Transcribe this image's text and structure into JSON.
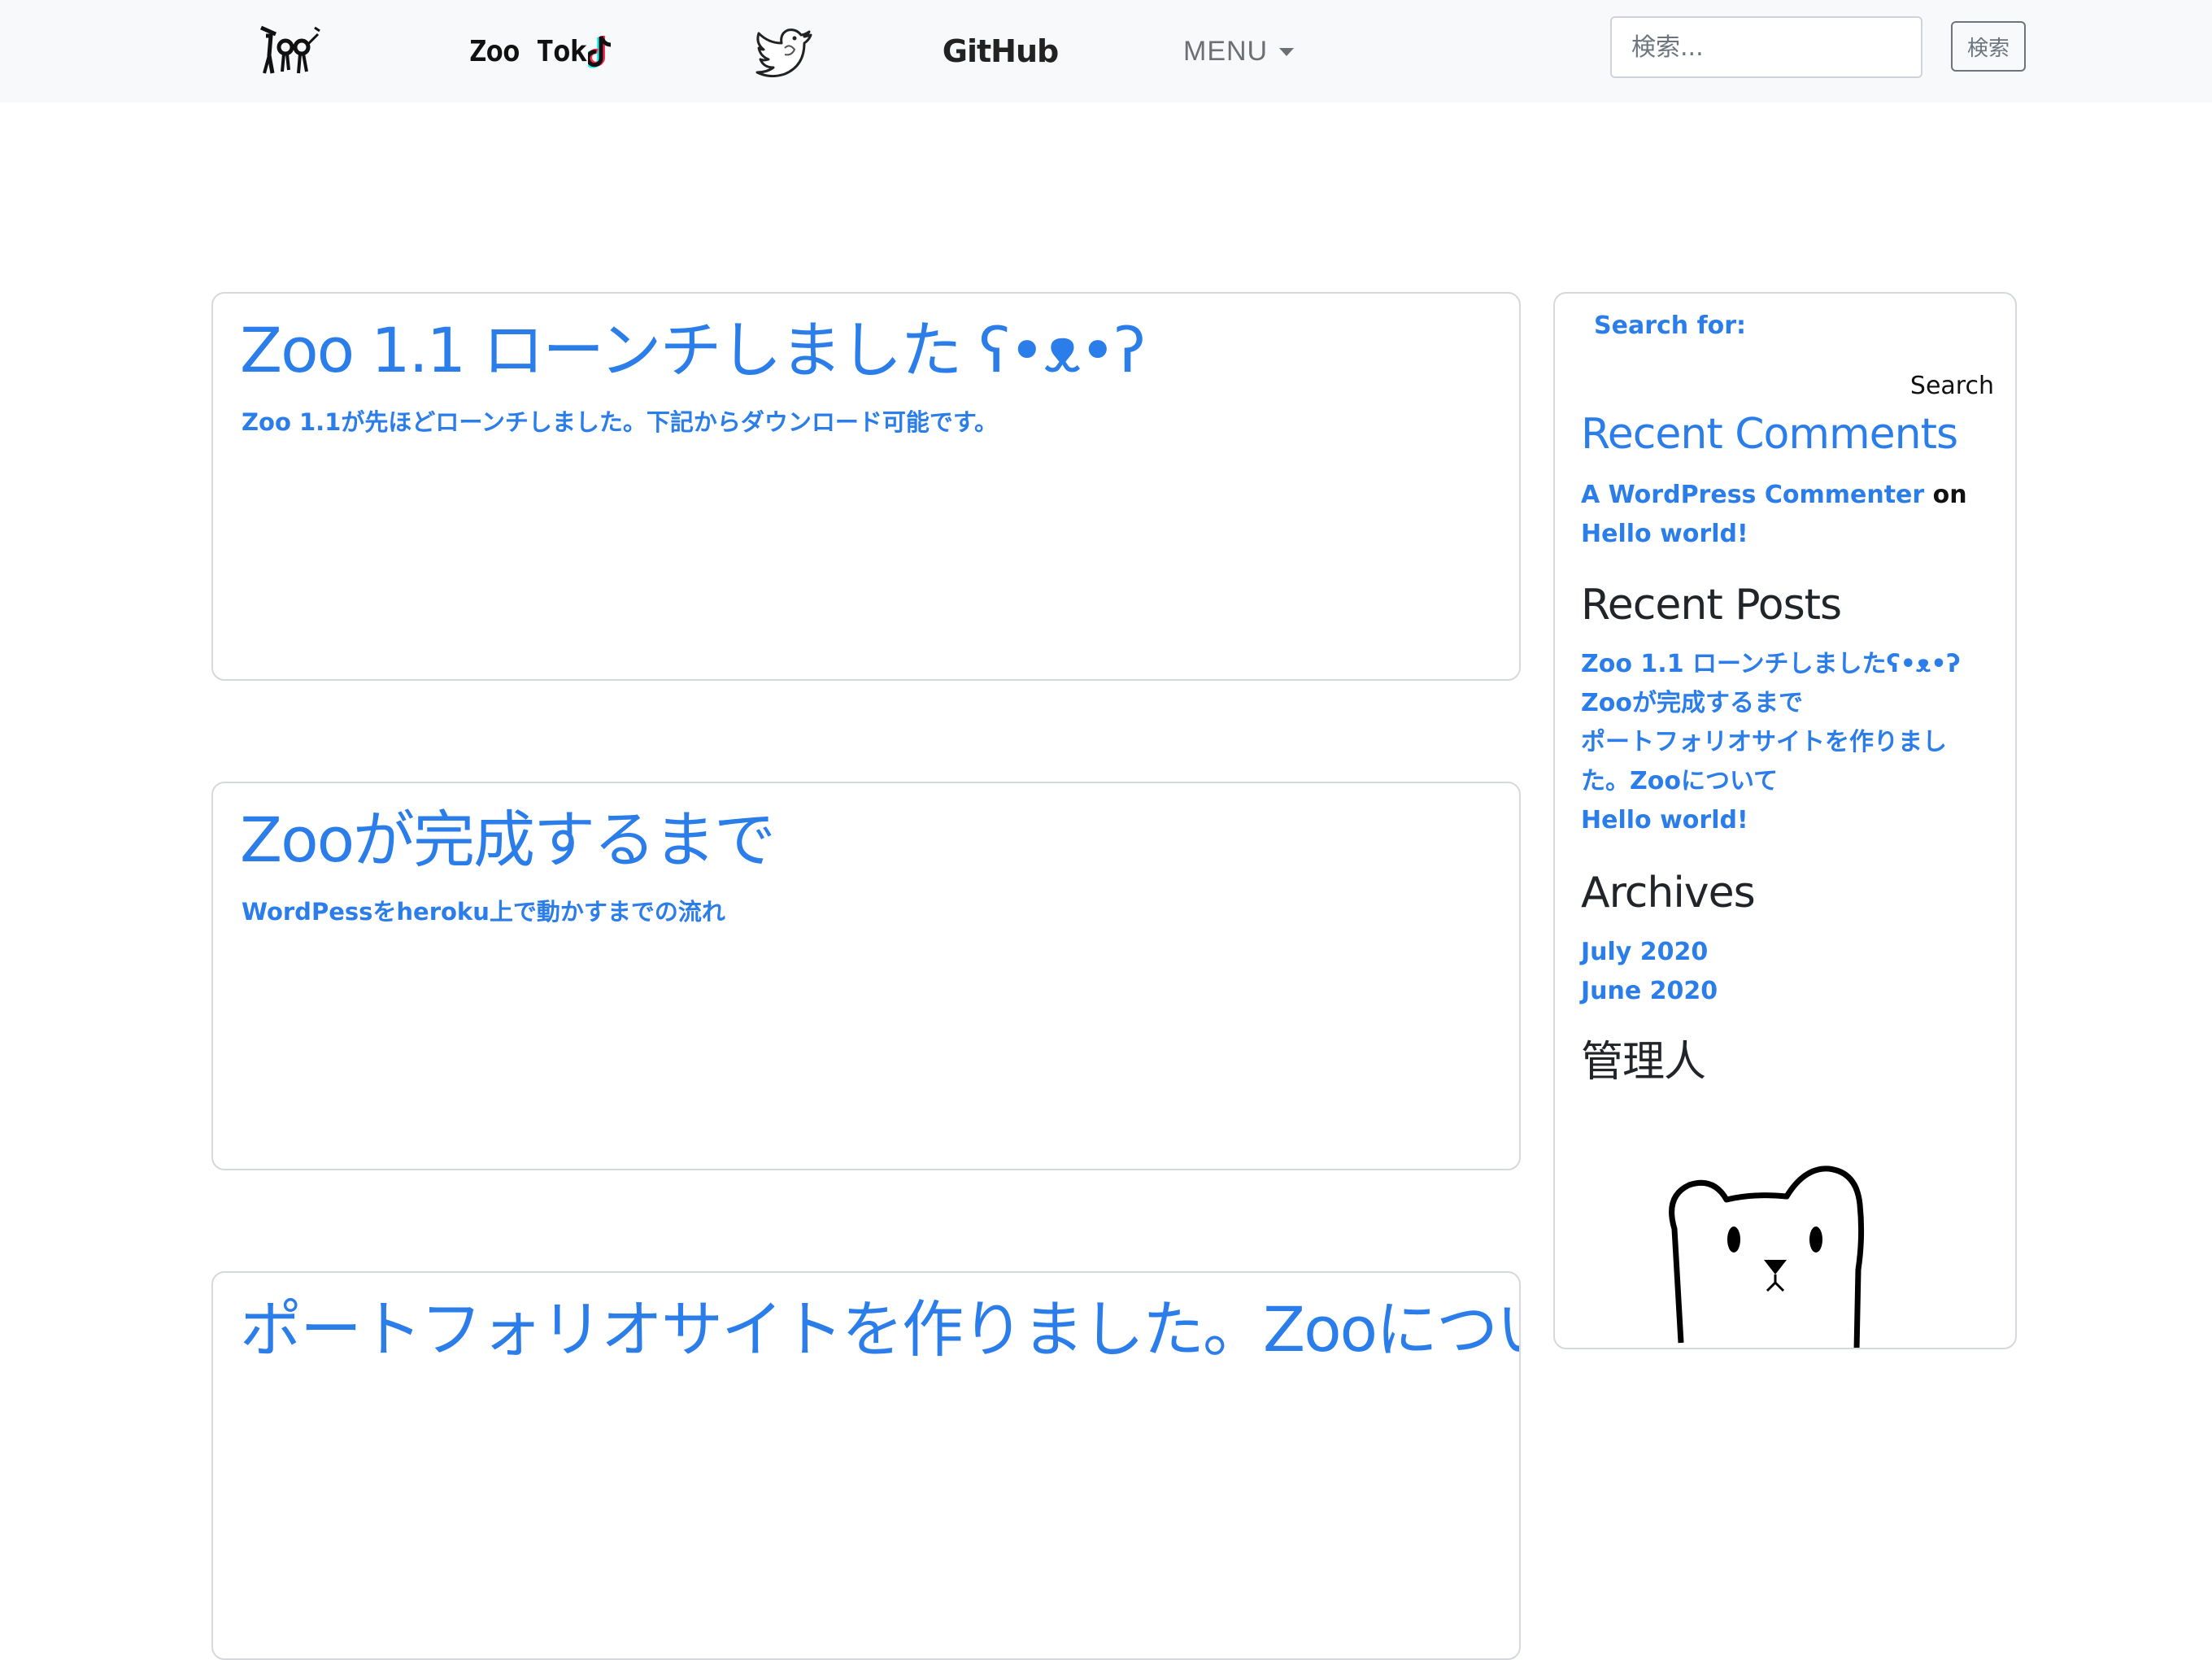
{
  "nav": {
    "zootok_label": "Zoo Tok",
    "github_label": "GitHub",
    "menu_label": "MENU",
    "search_placeholder": "検索...",
    "search_button": "検索"
  },
  "posts": [
    {
      "title": "Zoo 1.1 ローンチしました ʕ•ᴥ•ʔ",
      "excerpt": "Zoo 1.1が先ほどローンチしました。下記からダウンロード可能です。"
    },
    {
      "title": "Zooが完成するまで",
      "excerpt": "WordPessをheroku上で動かすまでの流れ"
    },
    {
      "title": "ポートフォリオサイトを作りました。Zooについて",
      "excerpt": ""
    }
  ],
  "sidebar": {
    "search_label": "Search for:",
    "search_button": "Search",
    "recent_comments_heading": "Recent Comments",
    "comment_author": "A WordPress Commenter",
    "comment_on": "on",
    "comment_post": "Hello world!",
    "recent_posts_heading": "Recent Posts",
    "recent_posts": [
      "Zoo 1.1 ローンチしましたʕ•ᴥ•ʔ",
      "Zooが完成するまで",
      "ポートフォリオサイトを作りまし",
      "た。Zooについて",
      "Hello world!"
    ],
    "archives_heading": "Archives",
    "archives": [
      "July 2020",
      "June 2020"
    ],
    "admin_heading": "管理人"
  },
  "colors": {
    "link": "#2b7de9",
    "navbar_bg": "#f8f9fa",
    "border": "#d5d8dc"
  },
  "icons": {
    "zoo_logo": "zoo-logo-icon",
    "twitter": "twitter-bird-icon",
    "tiktok_note": "tiktok-note-icon",
    "avatar": "bear-avatar-icon"
  }
}
